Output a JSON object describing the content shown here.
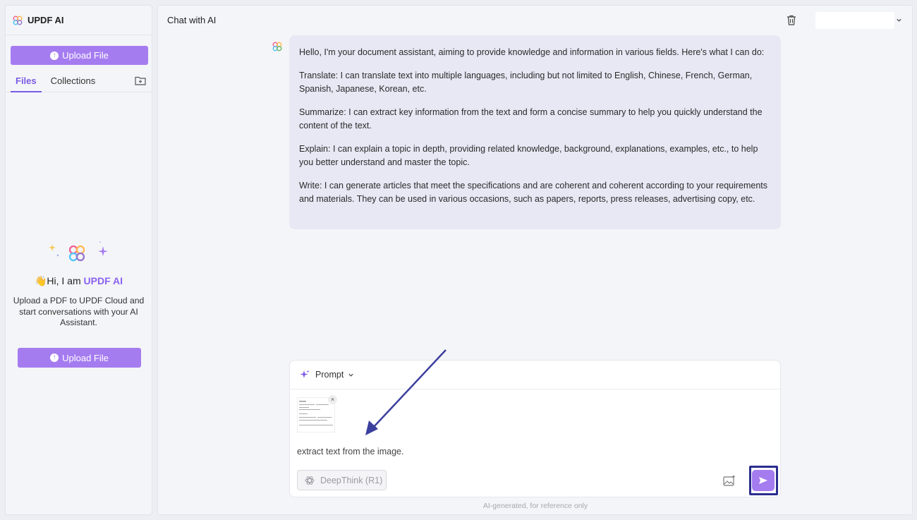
{
  "sidebar": {
    "app_title": "UPDF AI",
    "upload_button": "Upload File",
    "tabs": [
      "Files",
      "Collections"
    ],
    "welcome_wave": "👋",
    "welcome_prefix": "Hi, I am ",
    "welcome_brand": "UPDF AI",
    "welcome_desc": "Upload a PDF to UPDF Cloud and start conversations with your AI Assistant.",
    "upload_button_2": "Upload File"
  },
  "main": {
    "title": "Chat with AI",
    "message": [
      "Hello, I'm your document assistant, aiming to provide knowledge and information in various fields. Here's what I can do:",
      "Translate: I can translate text into multiple languages, including but not limited to English, Chinese, French, German, Spanish, Japanese, Korean, etc.",
      "Summarize: I can extract key information from the text and form a concise summary to help you quickly understand the content of the text.",
      "Explain: I can explain a topic in depth, providing related knowledge, background, explanations, examples, etc., to help you better understand and master the topic.",
      "Write: I can generate articles that meet the specifications and are coherent and coherent according to your requirements and materials. They can be used in various occasions, such as papers, reports, press releases, advertising copy, etc."
    ],
    "composer": {
      "prompt_label": "Prompt",
      "attachment_close": "×",
      "input_text": "extract text from the image.",
      "deepthink_label": "DeepThink (R1)"
    },
    "footnote": "AI-generated, for reference only"
  },
  "colors": {
    "accent": "#a57cf0",
    "brand_text": "#8a62ee",
    "highlight_frame": "#2a2d8e",
    "bubble_bg": "#e8e8f5"
  },
  "icons": [
    "updf-logo-icon",
    "upload-icon",
    "folder-add-icon",
    "trash-icon",
    "chevron-down-icon",
    "sparkle-icon",
    "image-icon",
    "send-icon",
    "deepthink-icon",
    "annotation-arrow"
  ]
}
